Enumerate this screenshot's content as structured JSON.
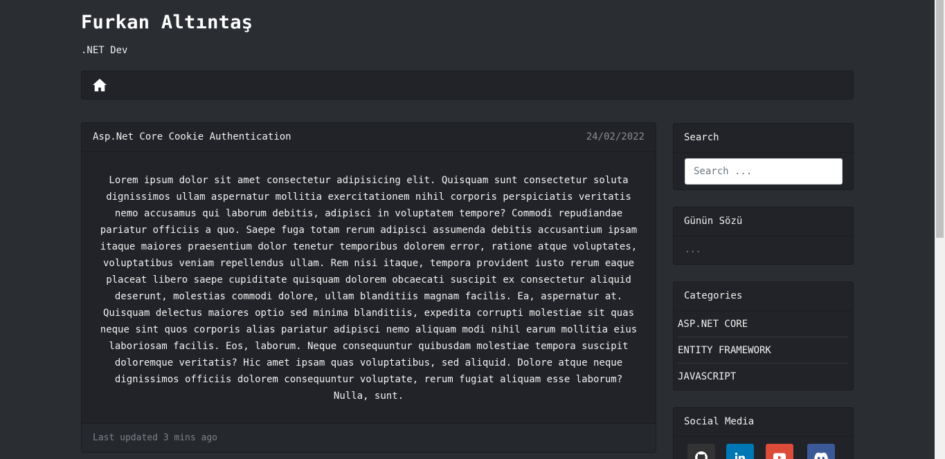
{
  "site": {
    "title": "Furkan Altıntaş",
    "subtitle": ".NET Dev"
  },
  "nav": {
    "home_icon": "home-icon"
  },
  "post": {
    "title": "Asp.Net Core Cookie Authentication",
    "date": "24/02/2022",
    "body": "Lorem ipsum dolor sit amet consectetur adipisicing elit. Quisquam sunt consectetur soluta dignissimos ullam aspernatur mollitia exercitationem nihil corporis perspiciatis veritatis nemo accusamus qui laborum debitis, adipisci in voluptatem tempore? Commodi repudiandae pariatur officiis a quo. Saepe fuga totam rerum adipisci assumenda debitis accusantium ipsam itaque maiores praesentium dolor tenetur temporibus dolorem error, ratione atque voluptates, voluptatibus veniam repellendus ullam. Rem nisi itaque, tempora provident iusto rerum eaque placeat libero saepe cupiditate quisquam dolorem obcaecati suscipit ex consectetur aliquid deserunt, molestias commodi dolore, ullam blanditiis magnam facilis. Ea, aspernatur at. Quisquam delectus maiores optio sed minima blanditiis, expedita corrupti molestiae sit quas neque sint quos corporis alias pariatur adipisci nemo aliquam modi nihil earum mollitia eius laboriosam facilis. Eos, laborum. Neque consequuntur quibusdam molestiae tempora suscipit doloremque veritatis? Hic amet ipsam quas voluptatibus, sed aliquid. Dolore atque neque dignissimos officiis dolorem consequuntur voluptate, rerum fugiat aliquam esse laborum? Nulla, sunt.",
    "updated": "Last updated 3 mins ago"
  },
  "sidebar": {
    "search": {
      "title": "Search",
      "placeholder": "Search ..."
    },
    "quote": {
      "title": "Günün Sözü",
      "text": "..."
    },
    "categories": {
      "title": "Categories",
      "items": [
        "ASP.NET CORE",
        "ENTITY FRAMEWORK",
        "JAVASCRIPT"
      ]
    },
    "social": {
      "title": "Social Media",
      "items": [
        {
          "icon": "github-icon",
          "color": "#333333"
        },
        {
          "icon": "linkedin-icon",
          "color": "#0077b5"
        },
        {
          "icon": "youtube-icon",
          "color": "#dd4b39"
        },
        {
          "icon": "discord-icon",
          "color": "#3b5998"
        }
      ]
    }
  },
  "colors": {
    "background": "#2a2d32",
    "card": "#212328",
    "muted": "#8a8d91"
  }
}
